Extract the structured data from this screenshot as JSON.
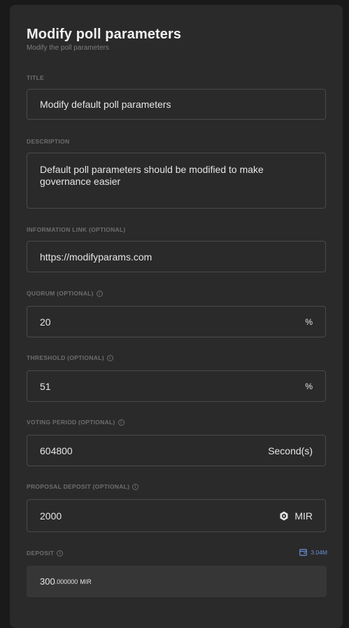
{
  "header": {
    "title": "Modify poll parameters",
    "subtitle": "Modify the poll parameters"
  },
  "fields": {
    "title": {
      "label": "TITLE",
      "value": "Modify default poll parameters"
    },
    "description": {
      "label": "DESCRIPTION",
      "value": "Default poll parameters should be modified to make governance easier"
    },
    "info_link": {
      "label": "INFORMATION LINK (OPTIONAL)",
      "value": "https://modifyparams.com"
    },
    "quorum": {
      "label": "QUORUM (OPTIONAL)",
      "value": "20",
      "unit": "%"
    },
    "threshold": {
      "label": "THRESHOLD (OPTIONAL)",
      "value": "51",
      "unit": "%"
    },
    "voting_period": {
      "label": "VOTING PERIOD (OPTIONAL)",
      "value": "604800",
      "unit": "Second(s)"
    },
    "proposal_deposit": {
      "label": "PROPOSAL DEPOSIT (OPTIONAL)",
      "value": "2000",
      "unit": "MIR"
    }
  },
  "deposit": {
    "label": "DEPOSIT",
    "balance": "3.04M",
    "amount_int": "300",
    "amount_dec": ".000000",
    "symbol": "MIR"
  },
  "icons": {
    "info": "info-icon",
    "wallet": "wallet-icon",
    "mir": "mir-token-icon"
  },
  "colors": {
    "background": "#1a1a1a",
    "card": "#2a2a2a",
    "accent": "#6b8fd6"
  }
}
